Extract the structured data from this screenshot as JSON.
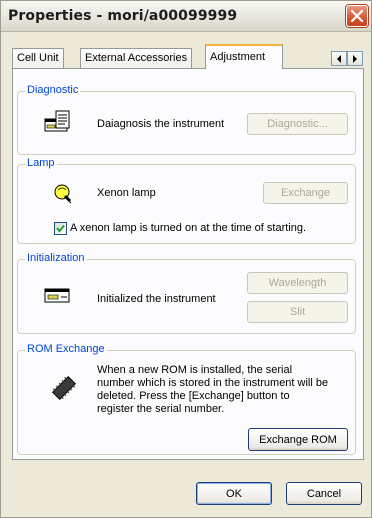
{
  "window": {
    "title": "Properties - mori/a00099999"
  },
  "tabs": [
    {
      "label": "Cell Unit"
    },
    {
      "label": "External Accessories"
    },
    {
      "label": "Adjustment"
    }
  ],
  "diagnostic": {
    "group_label": "Diagnostic",
    "text": "Daiagnosis the instrument",
    "button": "Diagnostic..."
  },
  "lamp": {
    "group_label": "Lamp",
    "text": "Xenon lamp",
    "button": "Exchange",
    "checkbox_label": "A xenon lamp is turned on at the time of starting.",
    "checkbox_checked": true
  },
  "initialization": {
    "group_label": "Initialization",
    "text": "Initialized the instrument",
    "wavelength_button": "Wavelength",
    "slit_button": "Slit"
  },
  "rom": {
    "group_label": "ROM Exchange",
    "line1": "When a new ROM is installed, the serial",
    "line2": "number which is stored in the instrument will be",
    "line3": "deleted. Press the [Exchange] button to",
    "line4": "register the serial number.",
    "button": "Exchange ROM"
  },
  "footer": {
    "ok": "OK",
    "cancel": "Cancel"
  },
  "colors": {
    "group_label": "#0046d5",
    "active_tab_accent": "#f3b43e",
    "close_button": "#d8552f"
  }
}
